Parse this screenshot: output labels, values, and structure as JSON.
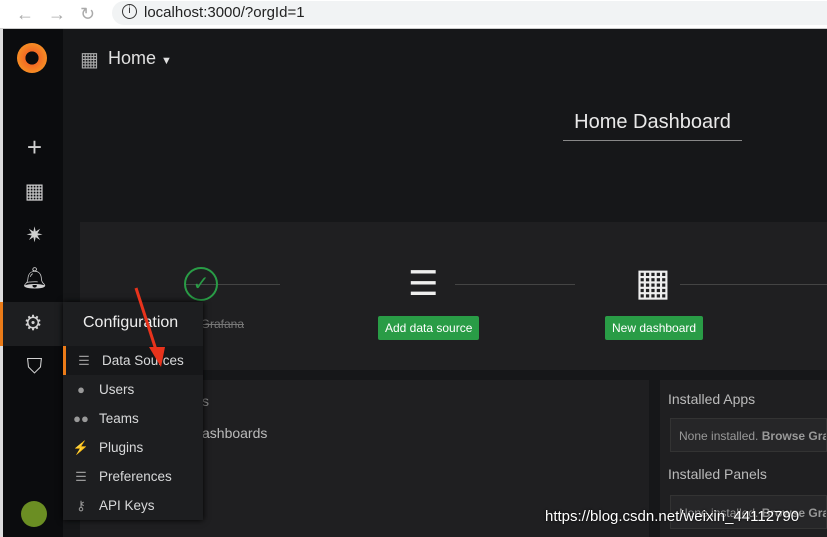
{
  "browser": {
    "url": "localhost:3000/?orgId=1"
  },
  "header": {
    "title": "Home"
  },
  "dashboard": {
    "title": "Home Dashboard"
  },
  "steps": [
    {
      "label": "Install Grafana"
    },
    {
      "label": "Add data source"
    },
    {
      "label": "New dashboard"
    }
  ],
  "config_menu": {
    "title": "Configuration",
    "items": [
      {
        "label": "Data Sources",
        "icon": "database-icon"
      },
      {
        "label": "Users",
        "icon": "user-icon"
      },
      {
        "label": "Teams",
        "icon": "users-icon"
      },
      {
        "label": "Plugins",
        "icon": "plug-icon"
      },
      {
        "label": "Preferences",
        "icon": "sliders-icon"
      },
      {
        "label": "API Keys",
        "icon": "key-icon"
      }
    ]
  },
  "left_panel": {
    "partial_title": "s",
    "partial_item": "ashboards"
  },
  "right_panel": {
    "apps_title": "Installed Apps",
    "apps_text": "None installed.",
    "apps_link": "Browse Graf",
    "panels_title": "Installed Panels",
    "panels_text": "None installed.",
    "panels_link": "Browse Graf"
  },
  "watermark": "https://blog.csdn.net/weixin_44112790",
  "colors": {
    "accent": "#eb7b18",
    "success": "#299c46",
    "arrow": "#e8331c"
  }
}
